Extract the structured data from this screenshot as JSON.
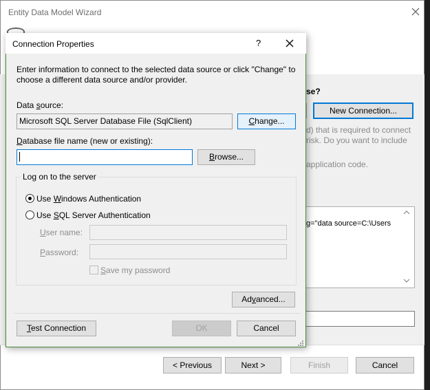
{
  "wizard": {
    "title": "Entity Data Model Wizard",
    "question_fragment": "se?",
    "new_connection_label": "New Connection...",
    "warning_line1": "d) that is required to connect",
    "warning_line2": "risk. Do you want to include",
    "warning_line3": "application code.",
    "connection_string_fragment": "g=\"data source=C:\\Users",
    "buttons": {
      "previous": "< Previous",
      "next": "Next >",
      "finish": "Finish",
      "cancel": "Cancel"
    }
  },
  "dialog": {
    "title": "Connection Properties",
    "help_label": "?",
    "description": "Enter information to connect to the selected data source or click \"Change\" to choose a different data source and/or provider.",
    "data_source": {
      "label_pre": "Data ",
      "label_access": "s",
      "label_post": "ource:",
      "value": "Microsoft SQL Server Database File (SqlClient)",
      "change_pre": "",
      "change_access": "C",
      "change_post": "hange..."
    },
    "db_file": {
      "label_pre": "",
      "label_access": "D",
      "label_post": "atabase file name (new or existing):",
      "value": "",
      "browse_pre": "",
      "browse_access": "B",
      "browse_post": "rowse..."
    },
    "logon": {
      "legend": "Log on to the server",
      "windows_auth": {
        "pre": "Use ",
        "access": "W",
        "post": "indows Authentication",
        "selected": true
      },
      "sql_auth": {
        "pre": "Use ",
        "access": "S",
        "post": "QL Server Authentication",
        "selected": false
      },
      "user_name": {
        "pre": "",
        "access": "U",
        "post": "ser name:",
        "value": ""
      },
      "password": {
        "pre": "",
        "access": "P",
        "post": "assword:",
        "value": ""
      },
      "save_password": {
        "pre": "",
        "access": "S",
        "post": "ave my password",
        "checked": false
      }
    },
    "advanced": {
      "pre": "Ad",
      "access": "v",
      "post": "anced..."
    },
    "test_connection": {
      "pre": "",
      "access": "T",
      "post": "est Connection"
    },
    "ok_label": "OK",
    "cancel_label": "Cancel"
  }
}
